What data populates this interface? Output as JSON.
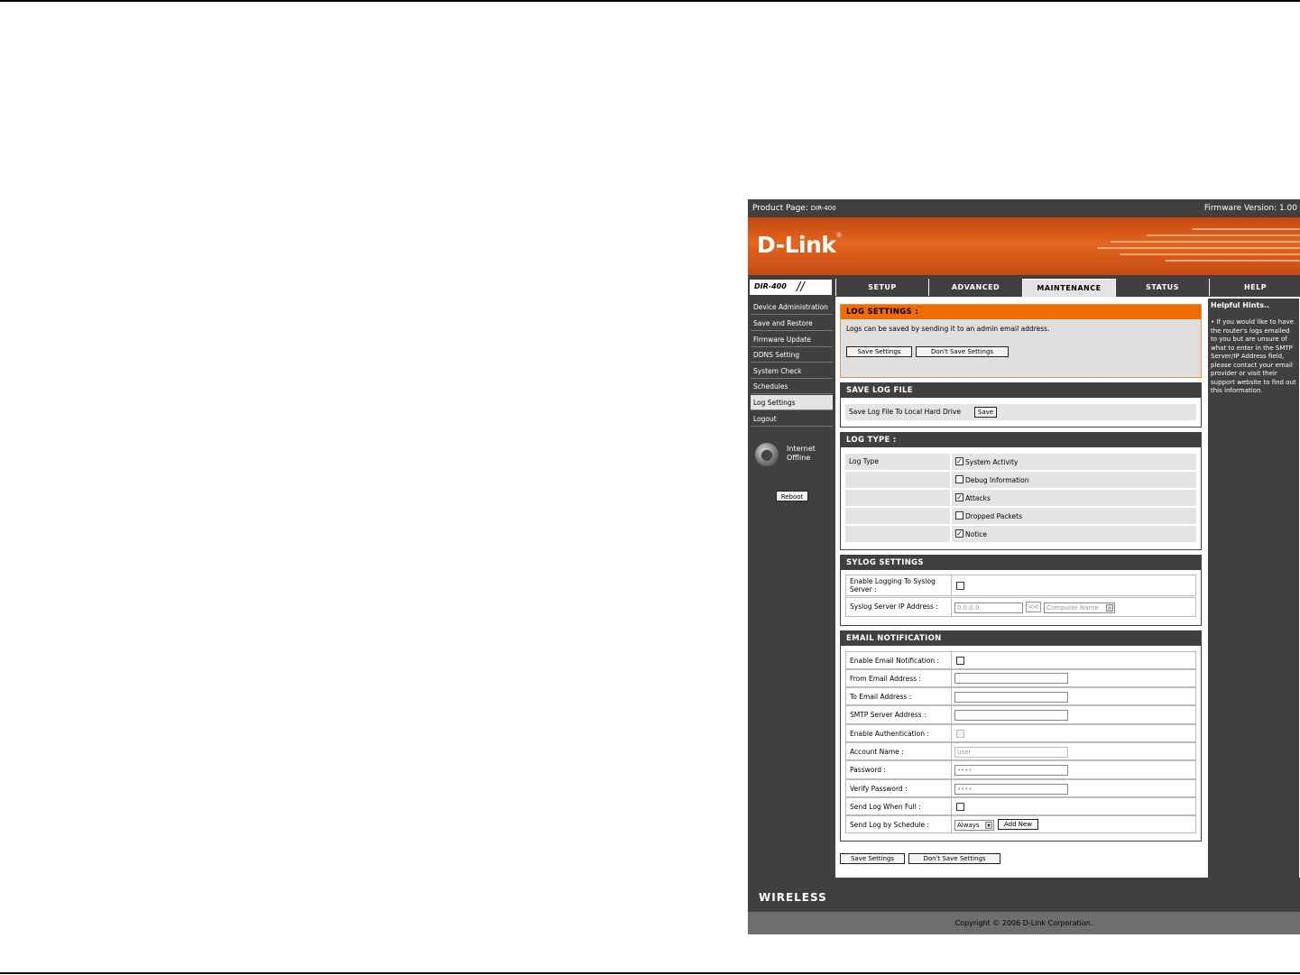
{
  "header": {
    "product_label": "Product Page:",
    "product_model": "DIR-400",
    "firmware": "Firmware Version: 1.00",
    "logo": "D-Link",
    "model_badge": "DIR-400"
  },
  "tabs": [
    {
      "label": "SETUP"
    },
    {
      "label": "ADVANCED"
    },
    {
      "label": "MAINTENANCE"
    },
    {
      "label": "STATUS"
    },
    {
      "label": "HELP"
    }
  ],
  "sidebar": {
    "items": [
      {
        "label": "Device Administration"
      },
      {
        "label": "Save and Restore"
      },
      {
        "label": "Firmware Update"
      },
      {
        "label": "DDNS Setting"
      },
      {
        "label": "System Check"
      },
      {
        "label": "Schedules"
      },
      {
        "label": "Log Settings"
      },
      {
        "label": "Logout"
      }
    ],
    "internet_status_line1": "Internet",
    "internet_status_line2": "Offline",
    "reboot_label": "Reboot"
  },
  "log_settings": {
    "title": "LOG SETTINGS :",
    "description": "Logs can be saved by sending it to an admin email address.",
    "save_label": "Save Settings",
    "dont_save_label": "Don't Save Settings"
  },
  "save_log_file": {
    "title": "SAVE LOG FILE",
    "label": "Save Log File To Local Hard Drive",
    "button": "Save"
  },
  "log_type": {
    "title": "LOG TYPE :",
    "row_label": "Log Type",
    "options": [
      {
        "label": "System Activity",
        "checked": "✓"
      },
      {
        "label": "Debug Information",
        "checked": ""
      },
      {
        "label": "Attacks",
        "checked": "✓"
      },
      {
        "label": "Dropped Packets",
        "checked": ""
      },
      {
        "label": "Notice",
        "checked": "✓"
      }
    ]
  },
  "syslog": {
    "title": "SYLOG SETTINGS",
    "enable_label_1": "Enable Logging To Syslog",
    "enable_label_2": "Server :",
    "ip_label": "Syslog Server IP Address :",
    "ip_value": "0.0.0.0",
    "copy_button": "<<",
    "computer_name": "Computer Name"
  },
  "email": {
    "title": "EMAIL NOTIFICATION",
    "enable_label": "Enable Email Notification :",
    "from_label": "From Email Address :",
    "to_label": "To Email Address :",
    "smtp_label": "SMTP Server Address :",
    "auth_label": "Enable Authentication :",
    "account_label": "Account Name :",
    "account_value": "user",
    "password_label": "Password :",
    "password_value": "••••",
    "verify_label": "Verify Password :",
    "verify_value": "••••",
    "full_label": "Send Log When Full :",
    "schedule_label": "Send Log by Schedule :",
    "schedule_value": "Always",
    "add_new": "Add New"
  },
  "bottom_buttons": {
    "save_label": "Save Settings",
    "dont_save_label": "Don't Save Settings"
  },
  "hints": {
    "title": "Helpful Hints..",
    "body": "• If you would like to have the router's logs emailed to you but are unsure of what to enter in the SMTP Server/IP Address field, please contact your email provider or visit their support website to find out this information."
  },
  "footer": {
    "brand": "WIRELESS",
    "copyright": "Copyright © 2006 D-Link Corporation."
  }
}
